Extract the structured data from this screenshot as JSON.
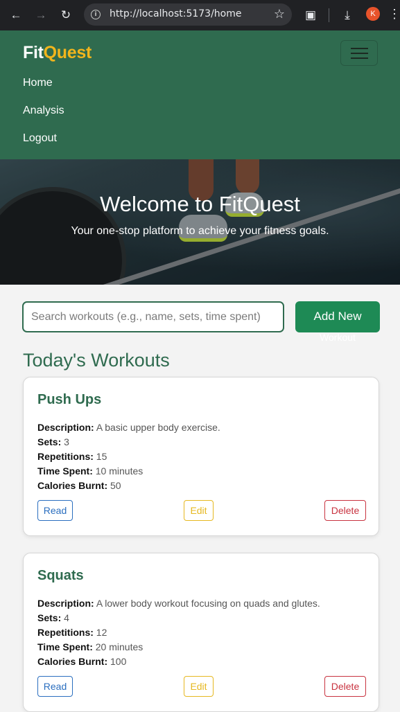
{
  "browser": {
    "url": "http://localhost:5173/home",
    "profile_initial": "K"
  },
  "navbar": {
    "brand_part1": "Fit",
    "brand_part2": "Quest",
    "links": [
      "Home",
      "Analysis",
      "Logout"
    ]
  },
  "hero": {
    "title": "Welcome to FitQuest",
    "subtitle": "Your one-stop platform to achieve your fitness goals."
  },
  "search": {
    "placeholder": "Search workouts (e.g., name, sets, time spent)",
    "value": ""
  },
  "add_button": {
    "line1": "Add New",
    "line2": "Workout"
  },
  "section_title": "Today's Workouts",
  "field_labels": {
    "description": "Description:",
    "sets": "Sets:",
    "repetitions": "Repetitions:",
    "time_spent": "Time Spent:",
    "calories": "Calories Burnt:"
  },
  "workouts": [
    {
      "name": "Push Ups",
      "description": "A basic upper body exercise.",
      "sets": "3",
      "repetitions": "15",
      "time_spent": "10 minutes",
      "calories": "50"
    },
    {
      "name": "Squats",
      "description": "A lower body workout focusing on quads and glutes.",
      "sets": "4",
      "repetitions": "12",
      "time_spent": "20 minutes",
      "calories": "100"
    }
  ],
  "card_buttons": {
    "read": "Read",
    "edit": "Edit",
    "delete": "Delete"
  },
  "colors": {
    "primary": "#2f6b4f",
    "accent": "#f2b51c",
    "add_button": "#1e8a55",
    "read": "#2a6ebf",
    "edit": "#e6b820",
    "delete": "#c8323f"
  }
}
